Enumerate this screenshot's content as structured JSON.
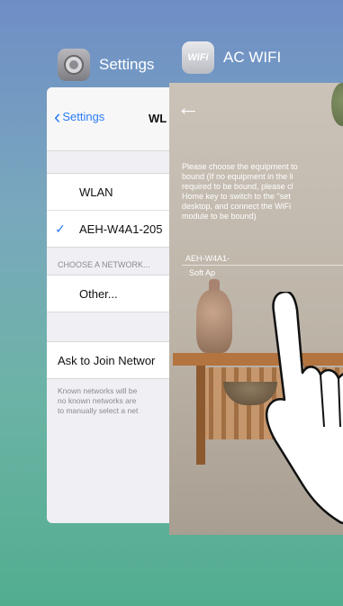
{
  "app_switcher": {
    "settings_app": {
      "name": "Settings",
      "icon": "gear-icon"
    },
    "acwifi_app": {
      "name": "AC WIFI",
      "icon_text": "WiFi"
    }
  },
  "settings_screen": {
    "back_label": "Settings",
    "title": "WL",
    "wlan_label": "WLAN",
    "connected_network": "AEH-W4A1-205",
    "choose_network_header": "CHOOSE A NETWORK...",
    "other_label": "Other...",
    "ask_to_join_label": "Ask to Join Networ",
    "footer_lines": [
      "Known networks will be",
      "no known networks are",
      "to manually select a net"
    ]
  },
  "acwifi_screen": {
    "instruction_lines": [
      "Please choose the equipment to",
      "bound (If no equipment in the li",
      "required to be bound, please cl",
      "Home key to switch to the \"set",
      "desktop, and connect the WiFi",
      "module to be bound)"
    ],
    "device_name": "AEH-W4A1-",
    "device_mode": "Soft Ap"
  },
  "colors": {
    "ios_blue": "#2a7cf6",
    "background_top": "#6f8ec6",
    "background_bottom": "#52ad8f"
  }
}
